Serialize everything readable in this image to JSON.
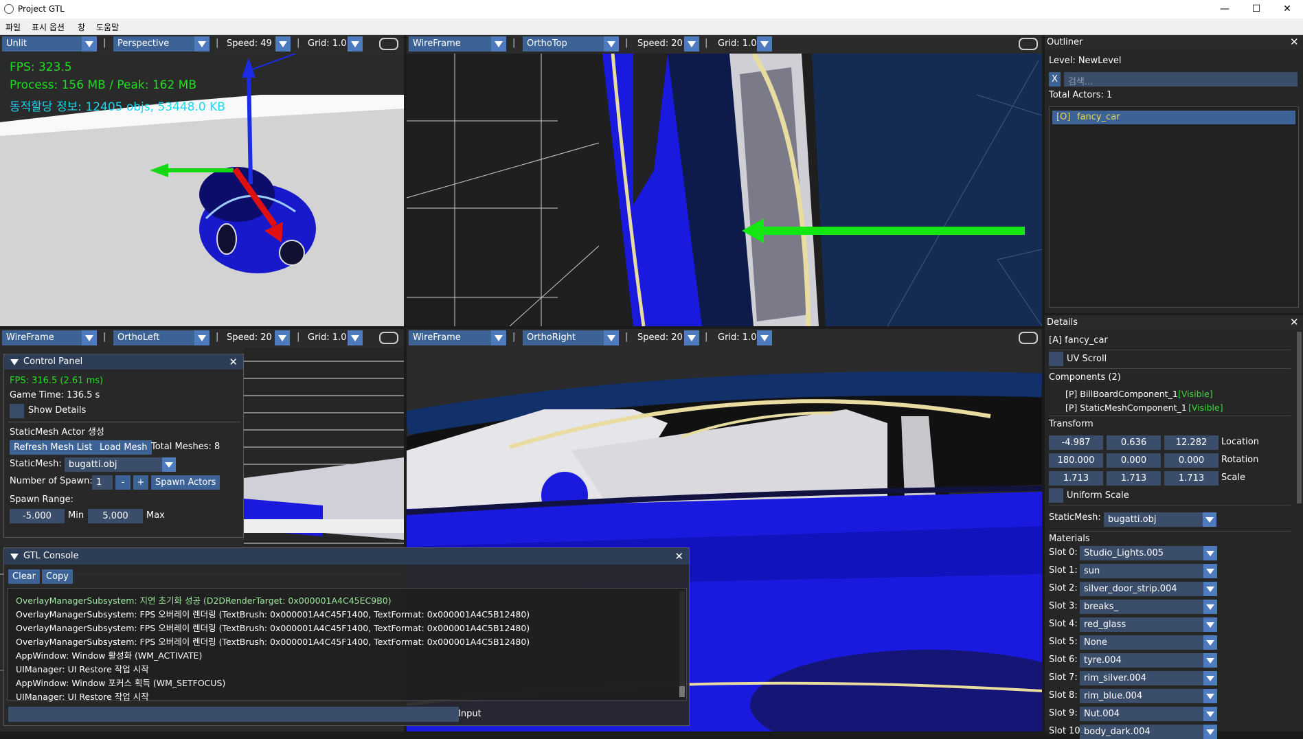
{
  "window": {
    "title": "Project GTL",
    "minimize": "—",
    "maximize": "☐",
    "close": "✕"
  },
  "menu": [
    "파일",
    "표시 옵션",
    "창",
    "도움말"
  ],
  "viewports": [
    {
      "shading": "Unlit",
      "projection": "Perspective",
      "speed": "Speed: 49",
      "grid": "Grid: 1.0"
    },
    {
      "shading": "WireFrame",
      "projection": "OrthoTop",
      "speed": "Speed: 20",
      "grid": "Grid: 1.0"
    },
    {
      "shading": "WireFrame",
      "projection": "OrthoLeft",
      "speed": "Speed: 20",
      "grid": "Grid: 1.0"
    },
    {
      "shading": "WireFrame",
      "projection": "OrthoRight",
      "speed": "Speed: 20",
      "grid": "Grid: 1.0"
    }
  ],
  "overlay": {
    "fps": "FPS: 323.5",
    "process": "Process: 156 MB / Peak: 162 MB",
    "alloc": "동적할당 정보: 12405 objs, 53448.0 KB"
  },
  "control_panel": {
    "title": "Control Panel",
    "fps": "FPS: 316.5 (2.61 ms)",
    "game_time": "Game Time: 136.5 s",
    "show_details": "Show Details",
    "section": "StaticMesh Actor 생성",
    "refresh": "Refresh Mesh List",
    "load": "Load Mesh",
    "total_meshes": "Total Meshes: 8",
    "static_mesh_label": "StaticMesh:",
    "static_mesh_value": "bugatti.obj",
    "num_spawn_label": "Number of Spawn:",
    "num_spawn_value": "1",
    "minus": "-",
    "plus": "+",
    "spawn_actors": "Spawn Actors",
    "spawn_range": "Spawn Range:",
    "min_value": "-5.000",
    "min_label": "Min",
    "max_value": "5.000",
    "max_label": "Max"
  },
  "console": {
    "title": "GTL Console",
    "clear": "Clear",
    "copy": "Copy",
    "input_label": "Input",
    "lines": [
      "OverlayManagerSubsystem: 지연 초기화 성공 (D2DRenderTarget: 0x000001A4C45EC9B0)",
      "OverlayManagerSubsystem: FPS 오버레이 렌더링 (TextBrush: 0x000001A4C45F1400, TextFormat: 0x000001A4C5B12480)",
      "OverlayManagerSubsystem: FPS 오버레이 렌더링 (TextBrush: 0x000001A4C45F1400, TextFormat: 0x000001A4C5B12480)",
      "OverlayManagerSubsystem: FPS 오버레이 렌더링 (TextBrush: 0x000001A4C45F1400, TextFormat: 0x000001A4C5B12480)",
      "AppWindow: Window 활성화 (WM_ACTIVATE)",
      "UIManager: UI Restore 작업 시작",
      "AppWindow: Window 포커스 획득 (WM_SETFOCUS)",
      "UIManager: UI Restore 작업 시작"
    ]
  },
  "outliner": {
    "title": "Outliner",
    "level": "Level: NewLevel",
    "clear": "X",
    "search_placeholder": "검색...",
    "total": "Total Actors: 1",
    "items": [
      {
        "tag": "[O]",
        "name": "fancy_car"
      }
    ]
  },
  "details": {
    "title": "Details",
    "actor": "[A]  fancy_car",
    "uv_scroll": "UV Scroll",
    "components_header": "Components (2)",
    "components": [
      {
        "name": "[P] BillBoardComponent_1",
        "state": "[Visible]"
      },
      {
        "name": "[P] StaticMeshComponent_1",
        "state": "[Visible]"
      }
    ],
    "transform": "Transform",
    "location": [
      "-4.987",
      "0.636",
      "12.282"
    ],
    "location_label": "Location",
    "rotation": [
      "180.000",
      "0.000",
      "0.000"
    ],
    "rotation_label": "Rotation",
    "scale": [
      "1.713",
      "1.713",
      "1.713"
    ],
    "scale_label": "Scale",
    "uniform_scale": "Uniform Scale",
    "static_mesh_label": "StaticMesh:",
    "static_mesh_value": "bugatti.obj",
    "materials": "Materials",
    "slots": [
      {
        "label": "Slot 0:",
        "value": "Studio_Lights.005"
      },
      {
        "label": "Slot 1:",
        "value": "sun"
      },
      {
        "label": "Slot 2:",
        "value": "silver_door_strip.004"
      },
      {
        "label": "Slot 3:",
        "value": "breaks_"
      },
      {
        "label": "Slot 4:",
        "value": "red_glass"
      },
      {
        "label": "Slot 5:",
        "value": "None"
      },
      {
        "label": "Slot 6:",
        "value": "tyre.004"
      },
      {
        "label": "Slot 7:",
        "value": "rim_silver.004"
      },
      {
        "label": "Slot 8:",
        "value": "rim_blue.004"
      },
      {
        "label": "Slot 9:",
        "value": "Nut.004"
      },
      {
        "label": "Slot 10:",
        "value": "body_dark.004"
      }
    ]
  },
  "colors": {
    "accent": "#4d7bbd",
    "combo": "#3d6396",
    "field": "#3a4e6c",
    "fps_green": "#1fe01f",
    "info_cyan": "#19d8f0",
    "wire_blue": "#1a1adf"
  }
}
